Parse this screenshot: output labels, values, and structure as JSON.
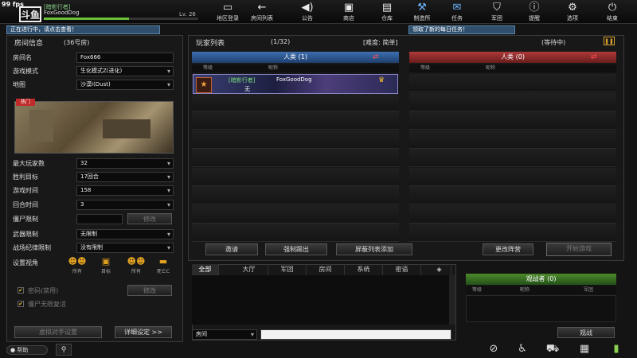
{
  "hud": {
    "fps": "99 fps",
    "logo": "斗鱼"
  },
  "player": {
    "tag": "[暗影行者]",
    "name": "FoxGoodDog",
    "level": "Lv. 26",
    "xp_fraction": 0.55
  },
  "notices": {
    "left": "正在进行中，请点击查看！",
    "right": "领取了新的每日任务！"
  },
  "nav": [
    {
      "label": "地区登录",
      "icon": "monitor-icon"
    },
    {
      "label": "房间列表",
      "icon": "back-arrow-icon"
    },
    {
      "label": "公告",
      "icon": "speaker-icon"
    },
    {
      "label": "商店",
      "icon": "shop-icon"
    },
    {
      "label": "仓库",
      "icon": "briefcase-icon"
    },
    {
      "label": "制造所",
      "icon": "craft-icon"
    },
    {
      "label": "任务",
      "icon": "task-icon"
    },
    {
      "label": "军团",
      "icon": "shield-icon"
    },
    {
      "label": "提醒",
      "icon": "alert-icon"
    },
    {
      "label": "选项",
      "icon": "gear-icon"
    },
    {
      "label": "结束",
      "icon": "power-icon"
    }
  ],
  "room": {
    "header": "房间信息",
    "room_no": "(36号房)",
    "fields": [
      {
        "label": "房间名",
        "value": "Fox666"
      },
      {
        "label": "游戏模式",
        "value": "生化模式Z(进化)"
      },
      {
        "label": "地图",
        "value": "沙漠Ⅰ(Dust)"
      }
    ],
    "hot_badge": "热门",
    "settings": [
      {
        "label": "最大玩家数",
        "value": "32"
      },
      {
        "label": "胜利目标",
        "value": "17回合"
      },
      {
        "label": "游戏时间",
        "value": "158"
      },
      {
        "label": "回合时间",
        "value": "3"
      },
      {
        "label": "僵尸限制",
        "value": "",
        "button": "修改"
      },
      {
        "label": "武器限制",
        "value": "无限制"
      },
      {
        "label": "战场纪律限制",
        "value": "没有限制"
      }
    ],
    "view_label": "设置视角",
    "views": [
      "所有",
      "目标",
      "所有",
      "死亡C"
    ],
    "password_label": "密码(禁用)",
    "password_button": "修改",
    "zombie_label": "僵尸无限复活",
    "bot_button": "虚拟对手设置",
    "detail_button": "详细设定 >>"
  },
  "player_list": {
    "header": "玩家列表",
    "count": "(1/32)",
    "difficulty": "[难度: 简单]",
    "status": "(等待中)",
    "team_left": "人类 (1)",
    "team_right": "人类 (0)",
    "col_level": "等级",
    "col_name": "昵称",
    "entry": {
      "tag": "[暗影行者]",
      "name": "FoxGoodDog",
      "sub": "无"
    },
    "buttons": {
      "invite": "邀请",
      "kick": "强制踢出",
      "block": "屏蔽列表添加",
      "change_team": "更改阵营",
      "start": "开始游戏"
    }
  },
  "chat": {
    "tabs": [
      "全部",
      "大厅",
      "军团",
      "房间",
      "系统",
      "密语"
    ],
    "channel": "房间",
    "input": ""
  },
  "spectator": {
    "header": "观战者 (0)",
    "col_level": "等级",
    "col_name": "昵称",
    "col_team": "军团",
    "button": "观战"
  },
  "footer": {
    "help": "帮助"
  }
}
